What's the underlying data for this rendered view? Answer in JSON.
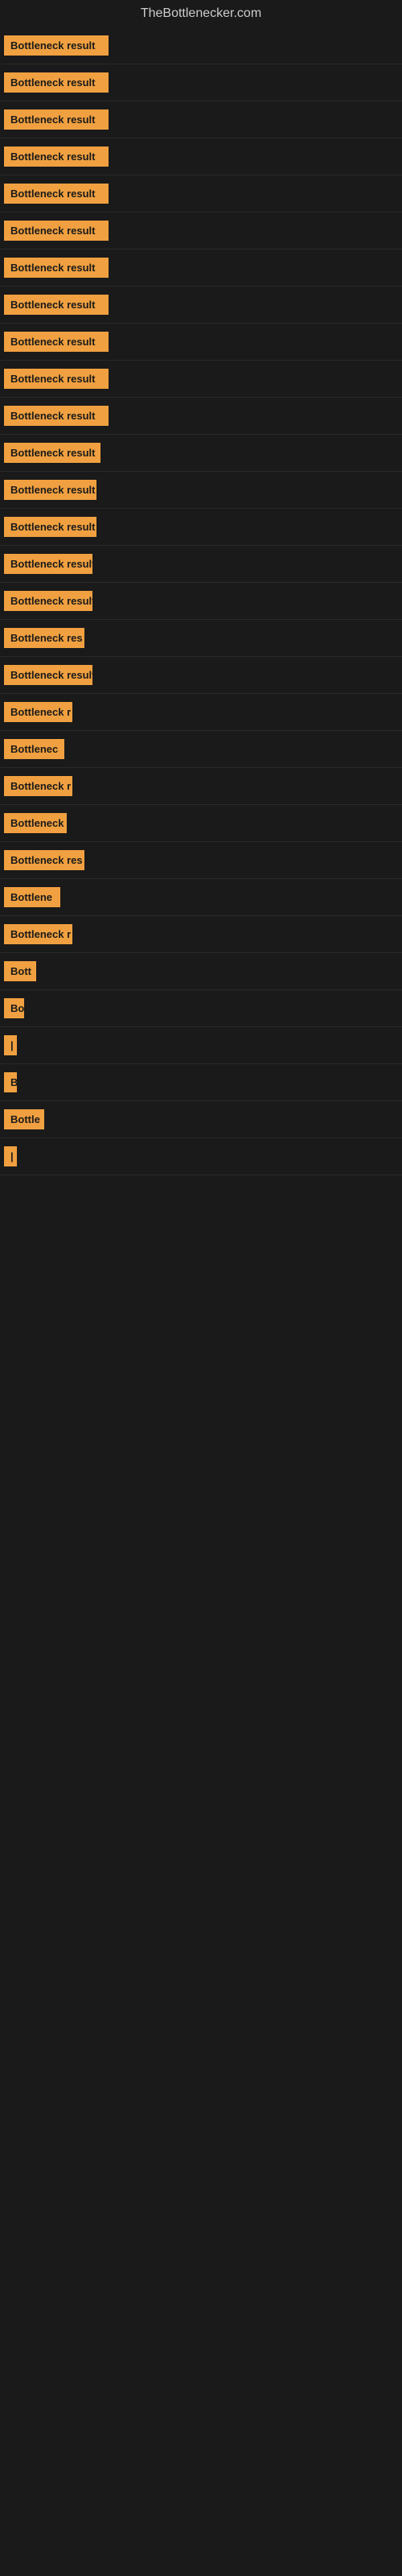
{
  "site": {
    "title": "TheBottlenecker.com"
  },
  "rows": [
    {
      "label": "Bottleneck result",
      "width": 130
    },
    {
      "label": "Bottleneck result",
      "width": 130
    },
    {
      "label": "Bottleneck result",
      "width": 130
    },
    {
      "label": "Bottleneck result",
      "width": 130
    },
    {
      "label": "Bottleneck result",
      "width": 130
    },
    {
      "label": "Bottleneck result",
      "width": 130
    },
    {
      "label": "Bottleneck result",
      "width": 130
    },
    {
      "label": "Bottleneck result",
      "width": 130
    },
    {
      "label": "Bottleneck result",
      "width": 130
    },
    {
      "label": "Bottleneck result",
      "width": 130
    },
    {
      "label": "Bottleneck result",
      "width": 130
    },
    {
      "label": "Bottleneck result",
      "width": 120
    },
    {
      "label": "Bottleneck result",
      "width": 115
    },
    {
      "label": "Bottleneck result",
      "width": 115
    },
    {
      "label": "Bottleneck result",
      "width": 110
    },
    {
      "label": "Bottleneck result",
      "width": 110
    },
    {
      "label": "Bottleneck res",
      "width": 100
    },
    {
      "label": "Bottleneck result",
      "width": 110
    },
    {
      "label": "Bottleneck r",
      "width": 85
    },
    {
      "label": "Bottlenec",
      "width": 75
    },
    {
      "label": "Bottleneck r",
      "width": 85
    },
    {
      "label": "Bottleneck",
      "width": 78
    },
    {
      "label": "Bottleneck res",
      "width": 100
    },
    {
      "label": "Bottlene",
      "width": 70
    },
    {
      "label": "Bottleneck r",
      "width": 85
    },
    {
      "label": "Bott",
      "width": 40
    },
    {
      "label": "Bo",
      "width": 25
    },
    {
      "label": "|",
      "width": 8
    },
    {
      "label": "B",
      "width": 15
    },
    {
      "label": "Bottle",
      "width": 50
    },
    {
      "label": "|",
      "width": 8
    }
  ]
}
